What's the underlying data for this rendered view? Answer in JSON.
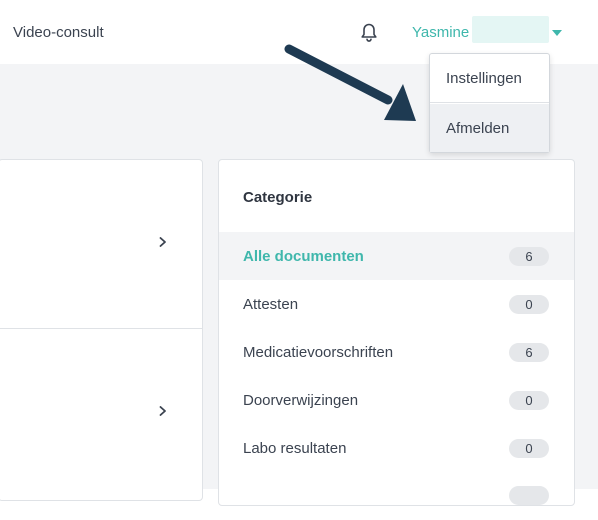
{
  "topbar": {
    "nav_link": "Video-consult",
    "notifications_icon": "bell-icon",
    "user_name": "Yasmine",
    "user_caret_icon": "caret-down-icon"
  },
  "user_menu": {
    "items": [
      {
        "label": "Instellingen"
      },
      {
        "label": "Afmelden"
      }
    ]
  },
  "categories": {
    "title": "Categorie",
    "items": [
      {
        "label": "Alle documenten",
        "count": "6"
      },
      {
        "label": "Attesten",
        "count": "0"
      },
      {
        "label": "Medicatievoorschriften",
        "count": "6"
      },
      {
        "label": "Doorverwijzingen",
        "count": "0"
      },
      {
        "label": "Labo resultaten",
        "count": "0"
      }
    ]
  },
  "colors": {
    "accent": "#3fb7ac",
    "arrow": "#1e3a52",
    "background": "#f3f4f6"
  }
}
